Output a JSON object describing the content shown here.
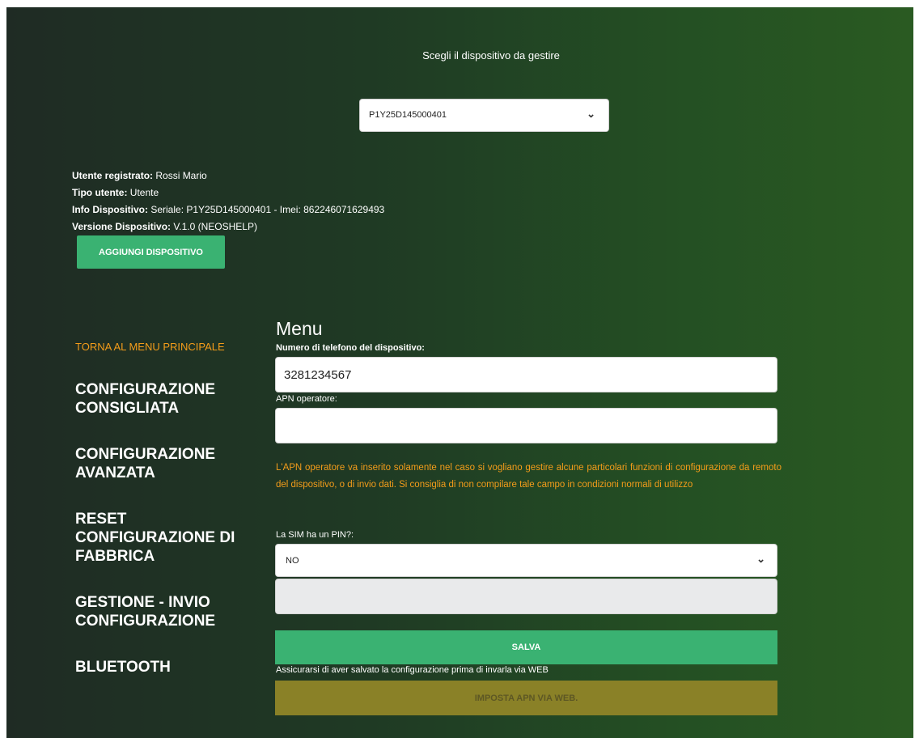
{
  "header": {
    "choose_title": "Scegli il dispositivo da gestire",
    "device_select_value": "P1Y25D145000401"
  },
  "info": {
    "user_label": "Utente registrato:",
    "user_value": " Rossi Mario",
    "type_label": "Tipo utente:",
    "type_value": " Utente",
    "device_label": "Info Dispositivo:",
    "device_value": " Seriale: P1Y25D145000401 - Imei: 862246071629493",
    "version_label": "Versione Dispositivo:",
    "version_value": " V.1.0 (NEOSHELP)",
    "add_button": "AGGIUNGI DISPOSITIVO"
  },
  "sidebar": {
    "back_link": "TORNA AL MENU PRINCIPALE",
    "items": [
      {
        "label": "CONFIGURAZIONE CONSIGLIATA"
      },
      {
        "label": "CONFIGURAZIONE AVANZATA"
      },
      {
        "label": "RESET CONFIGURAZIONE DI FABBRICA"
      },
      {
        "label": "GESTIONE - INVIO CONFIGURAZIONE"
      },
      {
        "label": "BLUETOOTH"
      }
    ]
  },
  "form": {
    "menu_title": "Menu",
    "phone_label": "Numero di telefono del dispositivo:",
    "phone_value": "3281234567",
    "apn_label": "APN operatore:",
    "apn_value": "",
    "apn_warning": "L'APN operatore va inserito solamente nel caso si vogliano gestire alcune particolari funzioni di configurazione da remoto del dispositivo, o di invio dati. Si consiglia di non compilare tale campo in condizioni normali di utilizzo",
    "pin_label": "La SIM ha un PIN?:",
    "pin_value": "NO",
    "pin_code_value": "",
    "save_button": "SALVA",
    "save_note": "Assicurarsi di aver salvato la configurazione prima di invarla via WEB",
    "web_button": "IMPOSTA APN VIA WEB."
  },
  "colors": {
    "accent_green": "#3ab272",
    "warning_orange": "#f39c1a",
    "web_button": "#8a8127"
  }
}
